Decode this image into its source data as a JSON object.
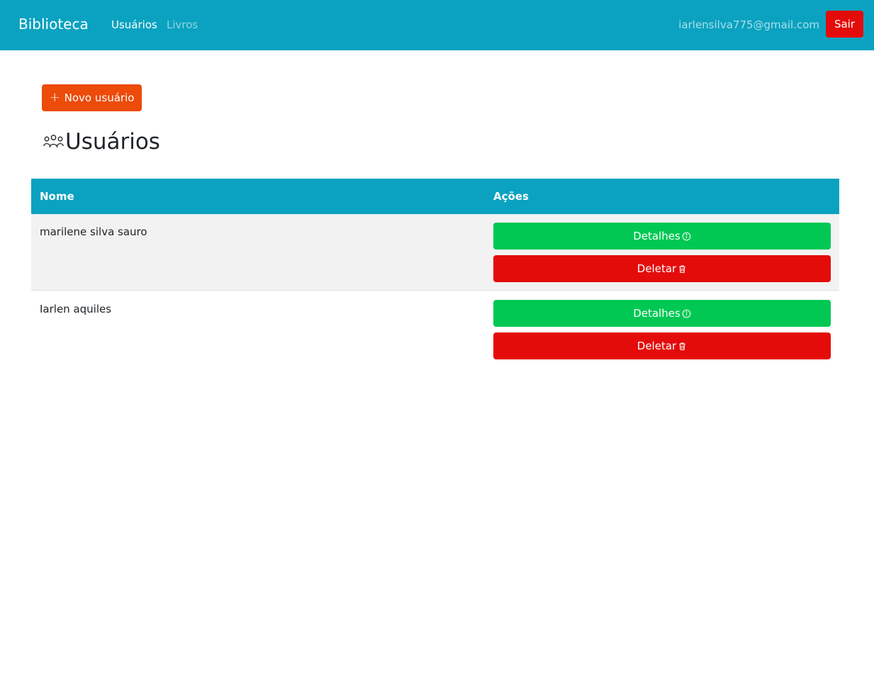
{
  "navbar": {
    "brand": "Biblioteca",
    "links": [
      {
        "label": "Usuários",
        "active": true
      },
      {
        "label": "Livros",
        "active": false
      }
    ],
    "user_email": "iarlensilva775@gmail.com",
    "logout_label": "Sair"
  },
  "toolbar": {
    "new_user_label": "Novo usuário"
  },
  "page": {
    "title": "Usuários",
    "title_icon": "people-icon"
  },
  "table": {
    "headers": [
      "Nome",
      "Ações"
    ],
    "rows": [
      {
        "name": "marilene silva sauro",
        "details_label": "Detalhes",
        "delete_label": "Deletar"
      },
      {
        "name": "Iarlen aquiles",
        "details_label": "Detalhes",
        "delete_label": "Deletar"
      }
    ]
  },
  "colors": {
    "navbar": "#0aa2c0",
    "new_button": "#ec4b09",
    "details_button": "#00c853",
    "delete_button": "#e40b0b"
  }
}
